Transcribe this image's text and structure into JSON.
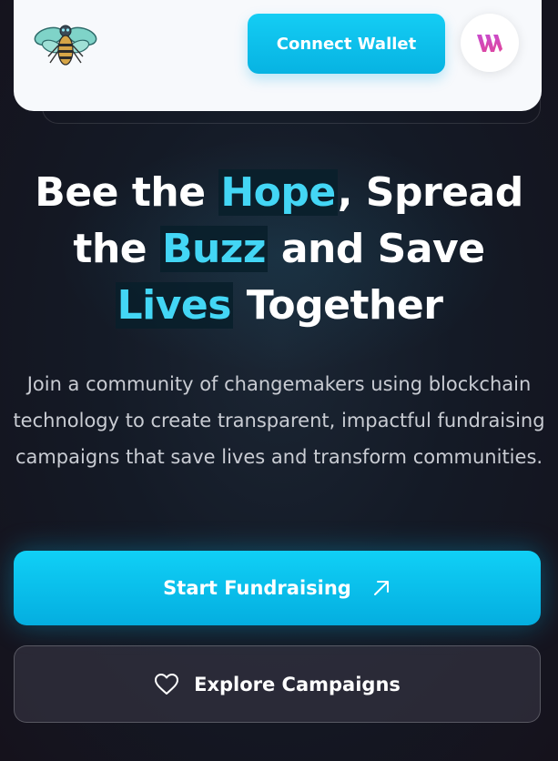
{
  "header": {
    "logo_icon": "bee-logo-icon",
    "connect_wallet_label": "Connect Wallet",
    "avatar_icon": "wallet-brand-icon"
  },
  "hero": {
    "headline": {
      "w1": "Bee the ",
      "hope": "Hope",
      "w2": ", Spread",
      "w3": "the ",
      "buzz": "Buzz",
      "w4": " and Save",
      "lives": "Lives",
      "w5": " Together"
    },
    "subtitle": "Join a community of changemakers using blockchain technology to create transparent, impactful fundraising campaigns that save lives and transform communities."
  },
  "actions": {
    "start_label": "Start Fundraising",
    "start_icon": "arrow-up-right-icon",
    "explore_label": "Explore Campaigns",
    "explore_icon": "heart-icon"
  },
  "colors": {
    "accent": "#12c8f0",
    "highlight_text": "#43d6f5",
    "background": "#141a26"
  }
}
